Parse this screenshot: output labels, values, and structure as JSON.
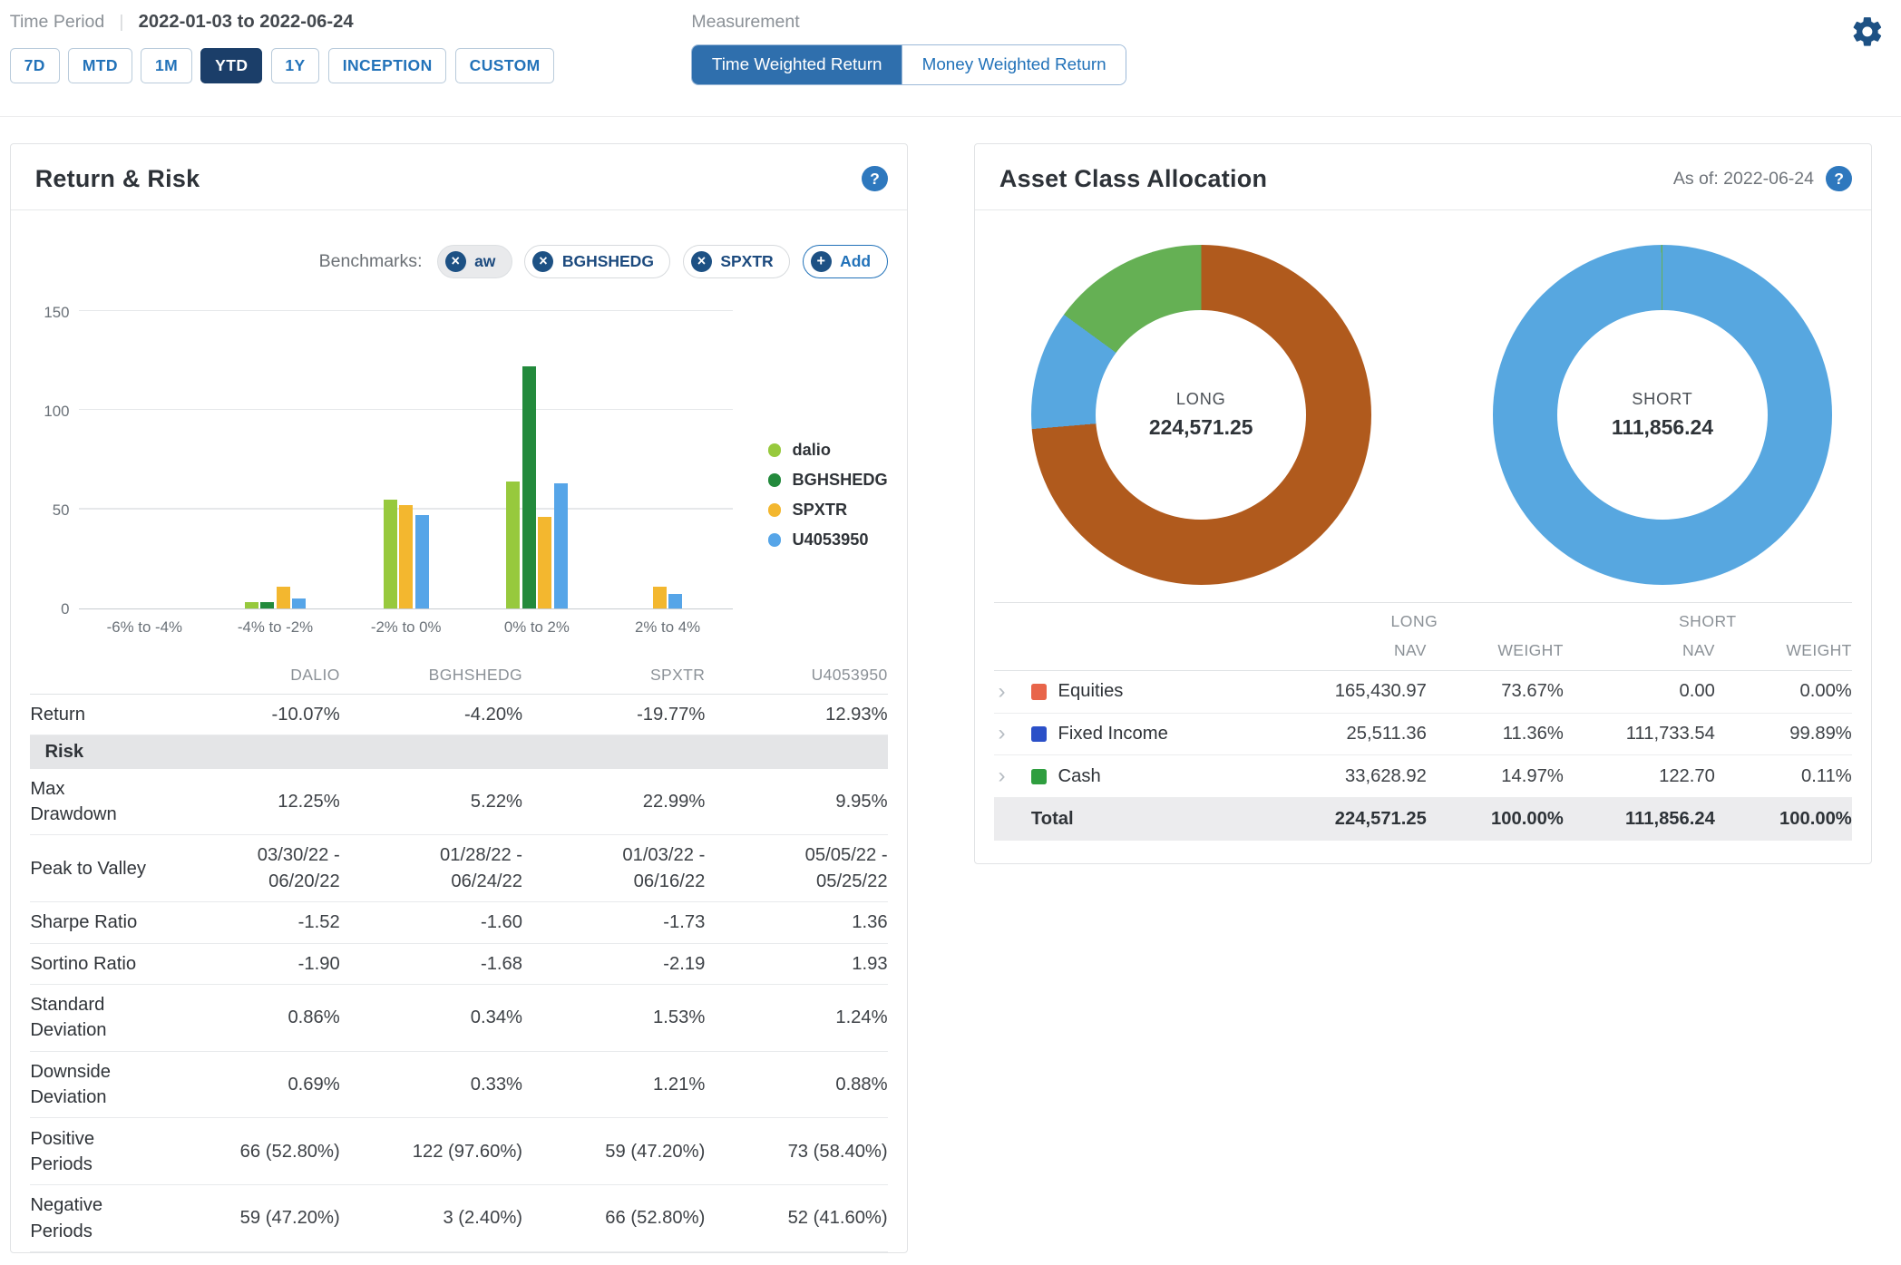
{
  "icons": {
    "gear": "⚙",
    "help": "?",
    "remove": "×",
    "add": "+",
    "chevron": "›"
  },
  "colors": {
    "navy": "#1b3e69",
    "blue": "#2272b9",
    "toggle_active": "#2f6fad",
    "help_badge": "#2e78be"
  },
  "header": {
    "time_period_label": "Time Period",
    "separator": "|",
    "date_range": "2022-01-03 to 2022-06-24",
    "period_buttons": [
      {
        "label": "7D",
        "active": false
      },
      {
        "label": "MTD",
        "active": false
      },
      {
        "label": "1M",
        "active": false
      },
      {
        "label": "YTD",
        "active": true
      },
      {
        "label": "1Y",
        "active": false
      },
      {
        "label": "INCEPTION",
        "active": false
      },
      {
        "label": "CUSTOM",
        "active": false
      }
    ],
    "measurement_label": "Measurement",
    "measurement_toggle": [
      {
        "label": "Time Weighted Return",
        "active": true
      },
      {
        "label": "Money Weighted Return",
        "active": false
      }
    ]
  },
  "return_risk": {
    "title": "Return & Risk",
    "benchmarks_label": "Benchmarks:",
    "benchmarks": [
      {
        "label": "aw",
        "highlighted": true
      },
      {
        "label": "BGHSHEDG",
        "highlighted": false
      },
      {
        "label": "SPXTR",
        "highlighted": false
      }
    ],
    "add_label": "Add",
    "table": {
      "columns": [
        "DALIO",
        "BGHSHEDG",
        "SPXTR",
        "U4053950"
      ],
      "rows": [
        {
          "label": "Return",
          "values": [
            "-10.07%",
            "-4.20%",
            "-19.77%",
            "12.93%"
          ]
        },
        {
          "type": "section",
          "label": "Risk"
        },
        {
          "label": "Max Drawdown",
          "values": [
            "12.25%",
            "5.22%",
            "22.99%",
            "9.95%"
          ]
        },
        {
          "label": "Peak to Valley",
          "values": [
            "03/30/22 - 06/20/22",
            "01/28/22 - 06/24/22",
            "01/03/22 - 06/16/22",
            "05/05/22 - 05/25/22"
          ]
        },
        {
          "label": "Sharpe Ratio",
          "values": [
            "-1.52",
            "-1.60",
            "-1.73",
            "1.36"
          ]
        },
        {
          "label": "Sortino Ratio",
          "values": [
            "-1.90",
            "-1.68",
            "-2.19",
            "1.93"
          ]
        },
        {
          "label": "Standard Deviation",
          "values": [
            "0.86%",
            "0.34%",
            "1.53%",
            "1.24%"
          ]
        },
        {
          "label": "Downside Deviation",
          "values": [
            "0.69%",
            "0.33%",
            "1.21%",
            "0.88%"
          ]
        },
        {
          "label": "Positive Periods",
          "values": [
            "66 (52.80%)",
            "122 (97.60%)",
            "59 (47.20%)",
            "73 (58.40%)"
          ]
        },
        {
          "label": "Negative Periods",
          "values": [
            "59 (47.20%)",
            "3 (2.40%)",
            "66 (52.80%)",
            "52 (41.60%)"
          ]
        }
      ]
    }
  },
  "chart_data": [
    {
      "type": "bar",
      "title": "",
      "categories": [
        "-6% to -4%",
        "-4% to -2%",
        "-2% to 0%",
        "0% to 2%",
        "2% to 4%"
      ],
      "series": [
        {
          "name": "dalio",
          "color": "#97c93d",
          "values": [
            0,
            3,
            55,
            64,
            0
          ]
        },
        {
          "name": "BGHSHEDG",
          "color": "#238a3c",
          "values": [
            0,
            3,
            0,
            122,
            0
          ]
        },
        {
          "name": "SPXTR",
          "color": "#f3b72f",
          "values": [
            0,
            11,
            52,
            46,
            11
          ]
        },
        {
          "name": "U4053950",
          "color": "#56a5e8",
          "values": [
            0,
            5,
            47,
            63,
            7
          ]
        }
      ],
      "xlabel": "",
      "ylabel": "",
      "ylim": [
        0,
        150
      ],
      "yticks": [
        0,
        50,
        100,
        150
      ],
      "grid": true,
      "legend_position": "right"
    },
    {
      "type": "pie",
      "title": "LONG",
      "center_value": "224,571.25",
      "slices": [
        {
          "name": "Equities",
          "value": 73.67,
          "color": "#b05a1d"
        },
        {
          "name": "Fixed Income",
          "value": 11.36,
          "color": "#57a7e0"
        },
        {
          "name": "Cash",
          "value": 14.97,
          "color": "#65b054"
        }
      ]
    },
    {
      "type": "pie",
      "title": "SHORT",
      "center_value": "111,856.24",
      "slices": [
        {
          "name": "Equities",
          "value": 0,
          "color": "#b05a1d"
        },
        {
          "name": "Fixed Income",
          "value": 99.89,
          "color": "#57a7e0"
        },
        {
          "name": "Cash",
          "value": 0.11,
          "color": "#65b054"
        }
      ]
    }
  ],
  "allocation": {
    "title": "Asset Class Allocation",
    "as_of": "As of: 2022-06-24",
    "long_label": "LONG",
    "short_label": "SHORT",
    "col_headers": [
      "NAV",
      "WEIGHT",
      "NAV",
      "WEIGHT"
    ],
    "rows": [
      {
        "label": "Equities",
        "color": "#e8654a",
        "values": [
          "165,430.97",
          "73.67%",
          "0.00",
          "0.00%"
        ]
      },
      {
        "label": "Fixed Income",
        "color": "#2b50c8",
        "values": [
          "25,511.36",
          "11.36%",
          "111,733.54",
          "99.89%"
        ]
      },
      {
        "label": "Cash",
        "color": "#2f9e3f",
        "values": [
          "33,628.92",
          "14.97%",
          "122.70",
          "0.11%"
        ]
      }
    ],
    "total_row": {
      "label": "Total",
      "values": [
        "224,571.25",
        "100.00%",
        "111,856.24",
        "100.00%"
      ]
    }
  }
}
